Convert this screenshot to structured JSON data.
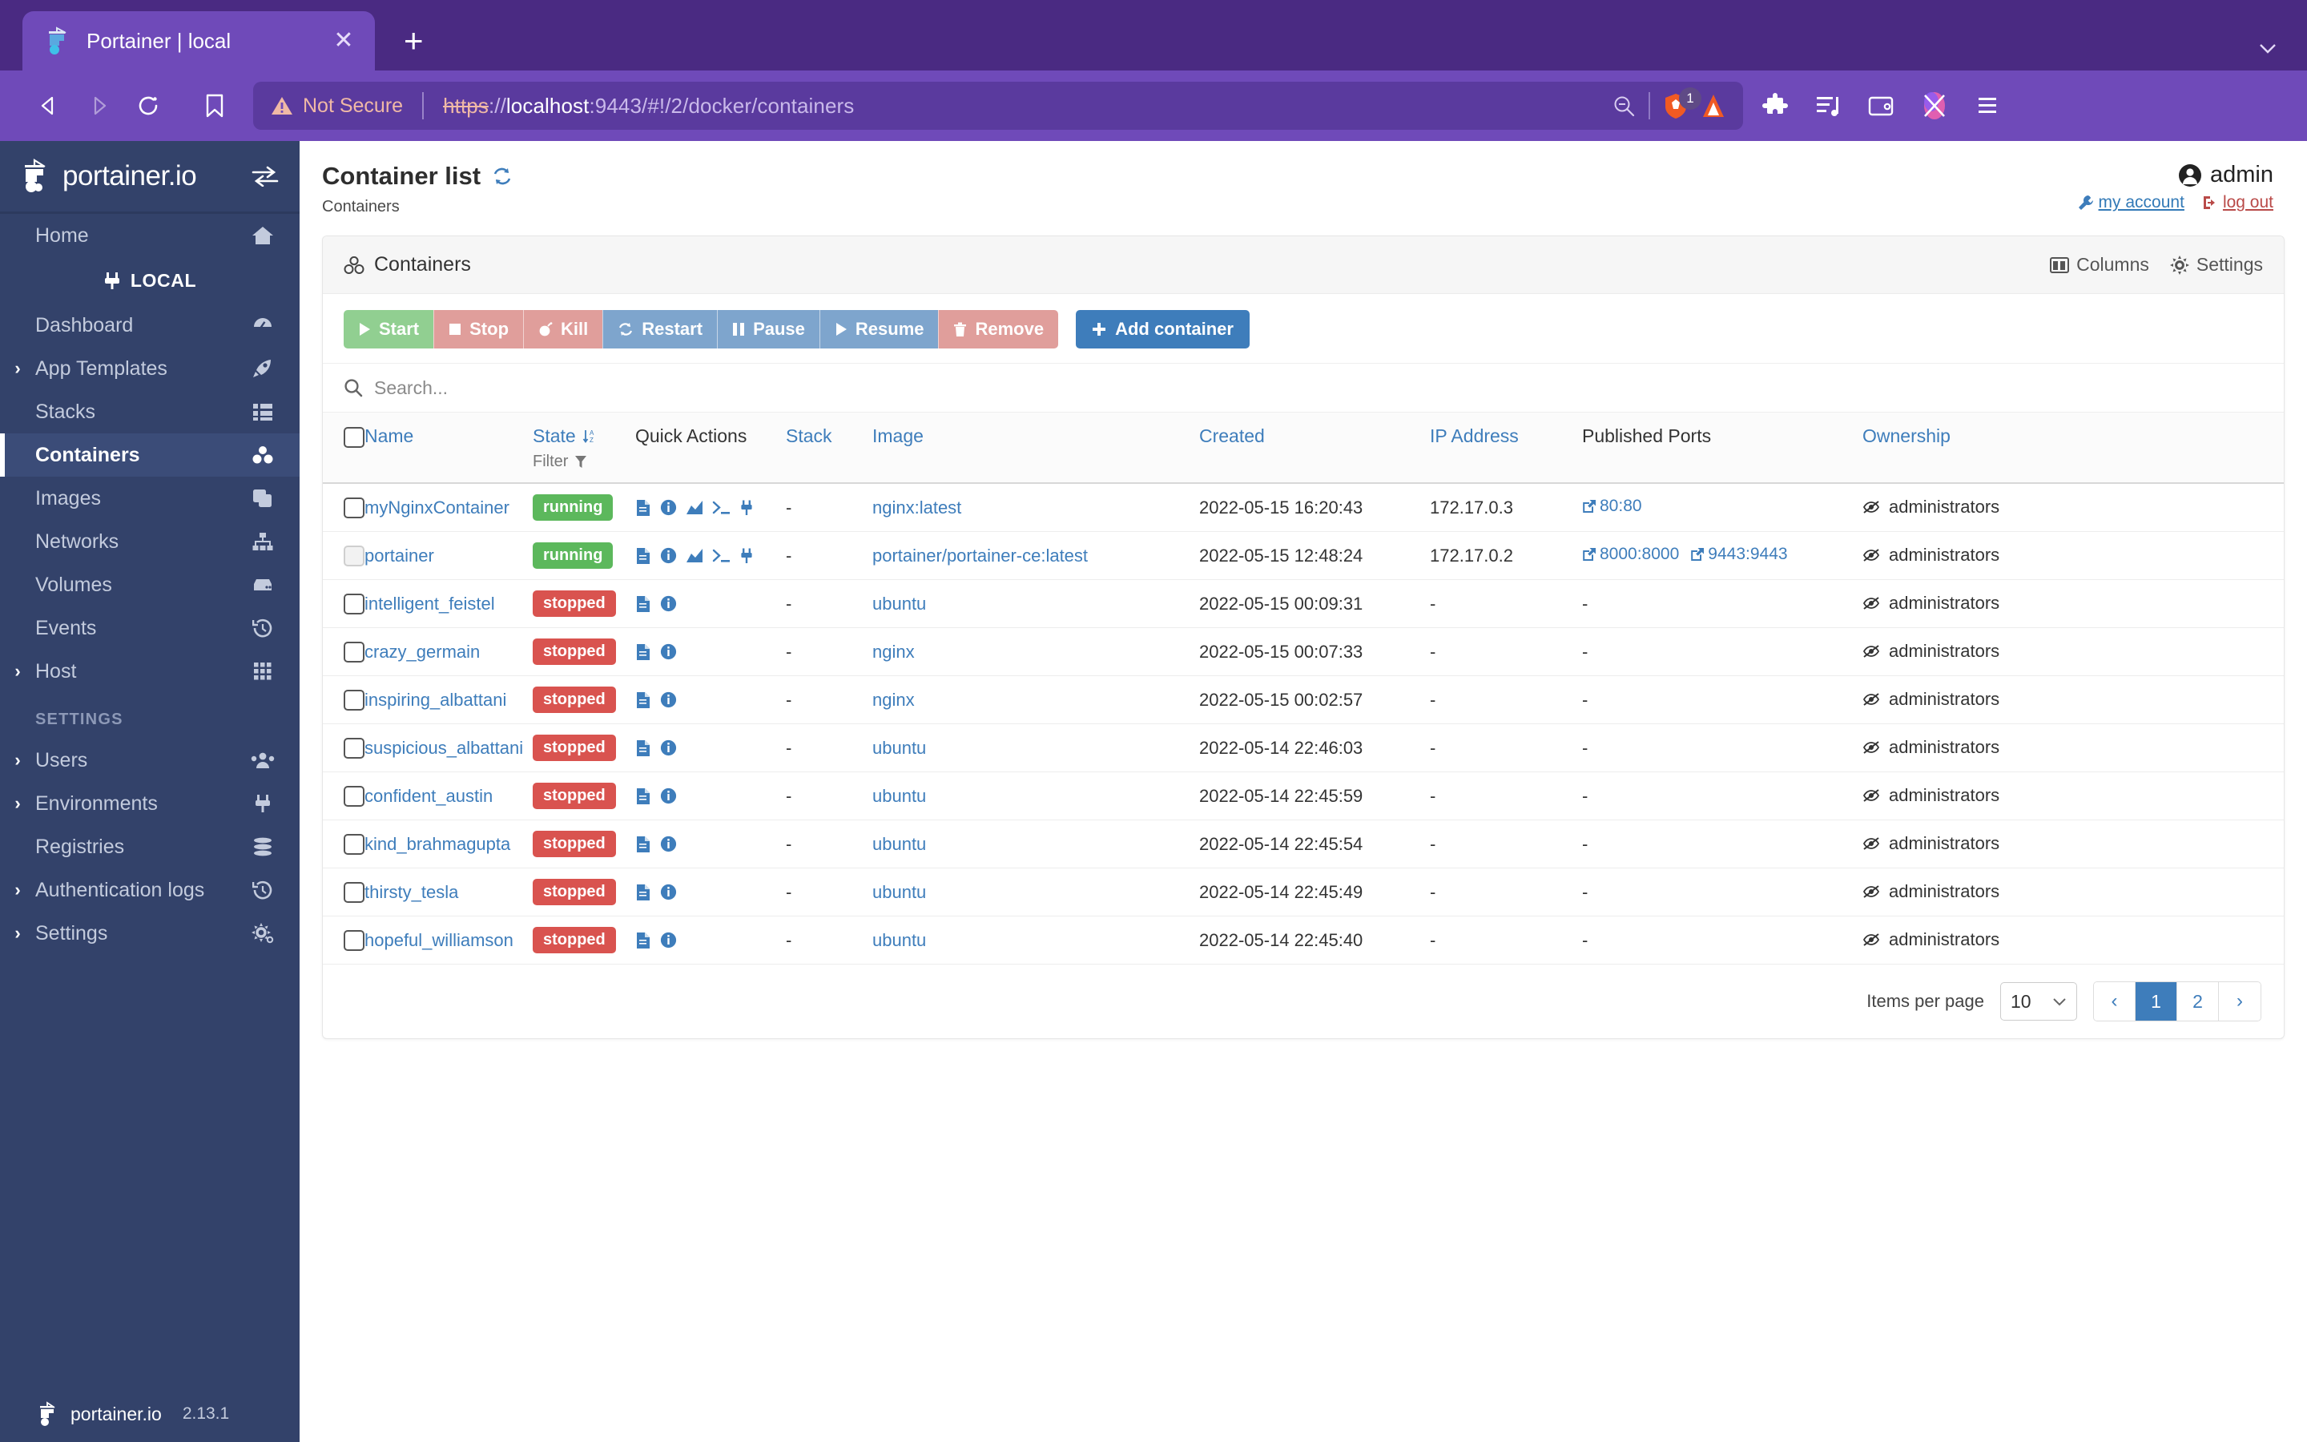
{
  "browser": {
    "tab": {
      "title": "Portainer | local",
      "favicon": "portainer-icon",
      "close_label": "✕"
    },
    "new_tab_label": "+",
    "tabstrip_menu_label": "⌄",
    "nav": {
      "back": "back-arrow",
      "forward": "forward-arrow",
      "reload": "reload-icon",
      "bookmark": "bookmark-icon"
    },
    "url": {
      "security_label": "Not Secure",
      "scheme": "https",
      "separator": "://",
      "host": "localhost",
      "port": ":9443",
      "path": "/#!/2/docker/containers",
      "full": "https://localhost:9443/#!/2/docker/containers"
    },
    "shield_count": "1",
    "toolbar_icons": [
      "zoom-out-icon",
      "brave-shields-icon",
      "brave-rewards-icon",
      "extensions-icon",
      "playlist-icon",
      "wallet-icon",
      "brave-leo-icon",
      "browser-menu-icon"
    ]
  },
  "sidebar": {
    "logo_text": "portainer.io",
    "toggle_icon": "collapse-sidebar-icon",
    "environment_badge": "LOCAL",
    "settings_heading": "SETTINGS",
    "items": [
      {
        "label": "Home",
        "icon": "home-icon",
        "expandable": false,
        "active": false
      },
      {
        "label": "Dashboard",
        "icon": "dashboard-icon",
        "expandable": false,
        "active": false
      },
      {
        "label": "App Templates",
        "icon": "rocket-icon",
        "expandable": true,
        "active": false
      },
      {
        "label": "Stacks",
        "icon": "stacks-icon",
        "expandable": false,
        "active": false
      },
      {
        "label": "Containers",
        "icon": "containers-icon",
        "expandable": false,
        "active": true
      },
      {
        "label": "Images",
        "icon": "images-icon",
        "expandable": false,
        "active": false
      },
      {
        "label": "Networks",
        "icon": "networks-icon",
        "expandable": false,
        "active": false
      },
      {
        "label": "Volumes",
        "icon": "volumes-icon",
        "expandable": false,
        "active": false
      },
      {
        "label": "Events",
        "icon": "events-icon",
        "expandable": false,
        "active": false
      },
      {
        "label": "Host",
        "icon": "host-icon",
        "expandable": true,
        "active": false
      }
    ],
    "settings_items": [
      {
        "label": "Users",
        "icon": "users-icon",
        "expandable": true
      },
      {
        "label": "Environments",
        "icon": "plug-icon",
        "expandable": true
      },
      {
        "label": "Registries",
        "icon": "registries-icon",
        "expandable": false
      },
      {
        "label": "Authentication logs",
        "icon": "history-icon",
        "expandable": true
      },
      {
        "label": "Settings",
        "icon": "gear-icon",
        "expandable": true
      }
    ],
    "footer": {
      "brand": "portainer.io",
      "version": "2.13.1"
    }
  },
  "header": {
    "title": "Container list",
    "refresh_icon": "refresh-icon",
    "breadcrumb": "Containers",
    "user": "admin",
    "user_icon": "user-circle-icon",
    "my_account": "my account",
    "log_out": "log out"
  },
  "card": {
    "title": "Containers",
    "title_icon": "containers-icon",
    "columns_label": "Columns",
    "columns_icon": "columns-icon",
    "settings_label": "Settings",
    "settings_icon": "gear-icon"
  },
  "actions": [
    {
      "label": "Start",
      "icon": "play-icon",
      "style": "green"
    },
    {
      "label": "Stop",
      "icon": "stop-icon",
      "style": "red"
    },
    {
      "label": "Kill",
      "icon": "bomb-icon",
      "style": "red"
    },
    {
      "label": "Restart",
      "icon": "restart-icon",
      "style": "blue"
    },
    {
      "label": "Pause",
      "icon": "pause-icon",
      "style": "blue"
    },
    {
      "label": "Resume",
      "icon": "play-icon",
      "style": "blue"
    },
    {
      "label": "Remove",
      "icon": "trash-icon",
      "style": "red"
    }
  ],
  "add_container": {
    "label": "Add container",
    "icon": "plus-icon"
  },
  "search": {
    "placeholder": "Search...",
    "value": "",
    "icon": "search-icon"
  },
  "table": {
    "headers": [
      {
        "label": "Name",
        "sortable": true,
        "link": true
      },
      {
        "label": "State",
        "sortable": true,
        "link": true,
        "sort_icon": "sort-asc-az-icon",
        "filter_label": "Filter",
        "filter_icon": "filter-icon"
      },
      {
        "label": "Quick Actions",
        "sortable": false,
        "link": false
      },
      {
        "label": "Stack",
        "sortable": true,
        "link": true
      },
      {
        "label": "Image",
        "sortable": true,
        "link": true
      },
      {
        "label": "Created",
        "sortable": true,
        "link": true
      },
      {
        "label": "IP Address",
        "sortable": true,
        "link": true
      },
      {
        "label": "Published Ports",
        "sortable": false,
        "link": false
      },
      {
        "label": "Ownership",
        "sortable": true,
        "link": true
      }
    ],
    "rows": [
      {
        "name": "myNginxContainer",
        "state": "running",
        "checkbox_disabled": false,
        "quick_actions": [
          "logs-icon",
          "inspect-icon",
          "stats-icon",
          "console-icon",
          "attach-icon"
        ],
        "stack": "-",
        "image": "nginx:latest",
        "created": "2022-05-15 16:20:43",
        "ip": "172.17.0.3",
        "ports": [
          "80:80"
        ],
        "ownership": "administrators"
      },
      {
        "name": "portainer",
        "state": "running",
        "checkbox_disabled": true,
        "quick_actions": [
          "logs-icon",
          "inspect-icon",
          "stats-icon",
          "console-icon",
          "attach-icon"
        ],
        "stack": "-",
        "image": "portainer/portainer-ce:latest",
        "created": "2022-05-15 12:48:24",
        "ip": "172.17.0.2",
        "ports": [
          "8000:8000",
          "9443:9443"
        ],
        "ownership": "administrators"
      },
      {
        "name": "intelligent_feistel",
        "state": "stopped",
        "checkbox_disabled": false,
        "quick_actions": [
          "logs-icon",
          "inspect-icon"
        ],
        "stack": "-",
        "image": "ubuntu",
        "created": "2022-05-15 00:09:31",
        "ip": "-",
        "ports": [],
        "ownership": "administrators"
      },
      {
        "name": "crazy_germain",
        "state": "stopped",
        "checkbox_disabled": false,
        "quick_actions": [
          "logs-icon",
          "inspect-icon"
        ],
        "stack": "-",
        "image": "nginx",
        "created": "2022-05-15 00:07:33",
        "ip": "-",
        "ports": [],
        "ownership": "administrators"
      },
      {
        "name": "inspiring_albattani",
        "state": "stopped",
        "checkbox_disabled": false,
        "quick_actions": [
          "logs-icon",
          "inspect-icon"
        ],
        "stack": "-",
        "image": "nginx",
        "created": "2022-05-15 00:02:57",
        "ip": "-",
        "ports": [],
        "ownership": "administrators"
      },
      {
        "name": "suspicious_albattani",
        "state": "stopped",
        "checkbox_disabled": false,
        "quick_actions": [
          "logs-icon",
          "inspect-icon"
        ],
        "stack": "-",
        "image": "ubuntu",
        "created": "2022-05-14 22:46:03",
        "ip": "-",
        "ports": [],
        "ownership": "administrators"
      },
      {
        "name": "confident_austin",
        "state": "stopped",
        "checkbox_disabled": false,
        "quick_actions": [
          "logs-icon",
          "inspect-icon"
        ],
        "stack": "-",
        "image": "ubuntu",
        "created": "2022-05-14 22:45:59",
        "ip": "-",
        "ports": [],
        "ownership": "administrators"
      },
      {
        "name": "kind_brahmagupta",
        "state": "stopped",
        "checkbox_disabled": false,
        "quick_actions": [
          "logs-icon",
          "inspect-icon"
        ],
        "stack": "-",
        "image": "ubuntu",
        "created": "2022-05-14 22:45:54",
        "ip": "-",
        "ports": [],
        "ownership": "administrators"
      },
      {
        "name": "thirsty_tesla",
        "state": "stopped",
        "checkbox_disabled": false,
        "quick_actions": [
          "logs-icon",
          "inspect-icon"
        ],
        "stack": "-",
        "image": "ubuntu",
        "created": "2022-05-14 22:45:49",
        "ip": "-",
        "ports": [],
        "ownership": "administrators"
      },
      {
        "name": "hopeful_williamson",
        "state": "stopped",
        "checkbox_disabled": false,
        "quick_actions": [
          "logs-icon",
          "inspect-icon"
        ],
        "stack": "-",
        "image": "ubuntu",
        "created": "2022-05-14 22:45:40",
        "ip": "-",
        "ports": [],
        "ownership": "administrators"
      }
    ]
  },
  "pagination": {
    "items_per_page_label": "Items per page",
    "items_per_page_value": "10",
    "prev": "‹",
    "next": "›",
    "pages": [
      "1",
      "2"
    ],
    "current_page": "1"
  },
  "colors": {
    "browser_purple": "#6f4ab9",
    "sidebar_navy": "#33426a",
    "accent_blue": "#3e7dbb",
    "running_green": "#5cb85c",
    "stopped_red": "#d9534f"
  }
}
